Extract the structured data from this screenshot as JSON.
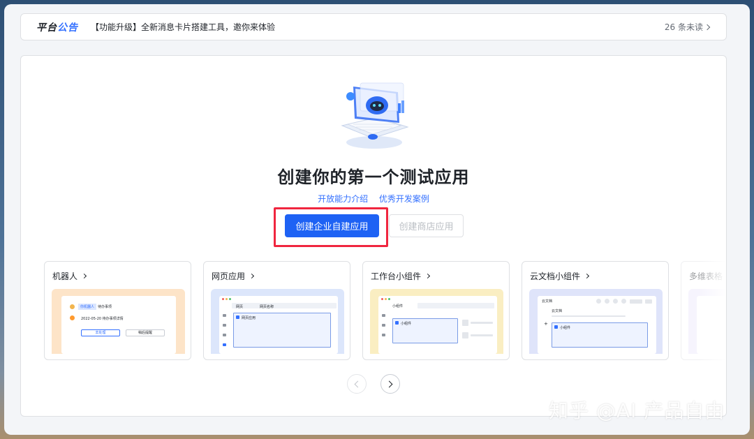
{
  "notice": {
    "brand_part1": "平台",
    "brand_part2": "公告",
    "text": "【功能升级】全新消息卡片搭建工具，邀你来体验",
    "count": "26 条未读"
  },
  "main": {
    "title": "创建你的第一个测试应用",
    "links": [
      "开放能力介绍",
      "优秀开发案例"
    ],
    "primary_button": "创建企业自建应用",
    "secondary_button": "创建商店应用"
  },
  "cards": [
    {
      "title": "机器人",
      "preview": {
        "tag": "你机器人",
        "tag_text": "待办事项",
        "line": "2022-05-20 待办事项详情",
        "btn1": "去处理",
        "btn2": "稍后提醒"
      }
    },
    {
      "title": "网页应用",
      "preview": {
        "tab1": "网页",
        "tab2": "网页名称",
        "box_label": "网页应用"
      }
    },
    {
      "title": "工作台小组件",
      "preview": {
        "tab": "小组件",
        "box_label": "小组件"
      }
    },
    {
      "title": "云文档小组件",
      "preview": {
        "back": "云文档",
        "label": "云文档",
        "box_label": "小组件"
      }
    },
    {
      "title": "多维表格"
    }
  ],
  "watermark": "知乎 @AI 产品自由",
  "colors": {
    "primary": "#1e62f4",
    "link": "#3370ff",
    "highlight_border": "#f0263f"
  }
}
